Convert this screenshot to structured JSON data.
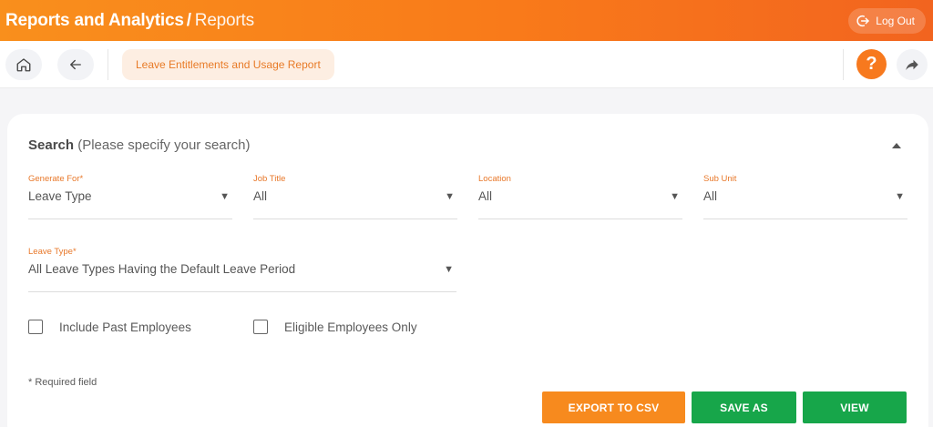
{
  "header": {
    "title": "Reports and Analytics",
    "separator": "/",
    "breadcrumb": "Reports",
    "logout_label": "Log Out"
  },
  "toolbar": {
    "home_icon": "home-icon",
    "back_icon": "arrow-left-icon",
    "active_tab": "Leave Entitlements and Usage Report",
    "help_label": "?",
    "share_icon": "share-icon"
  },
  "search": {
    "title": "Search",
    "subtitle": "(Please specify your search)",
    "fields": [
      {
        "label": "Generate For*",
        "value": "Leave Type"
      },
      {
        "label": "Job Title",
        "value": "All"
      },
      {
        "label": "Location",
        "value": "All"
      },
      {
        "label": "Sub Unit",
        "value": "All"
      },
      {
        "label": "Leave Type*",
        "value": "All Leave Types Having the Default Leave Period"
      }
    ],
    "checkboxes": [
      {
        "label": "Include Past Employees",
        "checked": false
      },
      {
        "label": "Eligible Employees Only",
        "checked": false
      }
    ],
    "required_note": "* Required field"
  },
  "actions": {
    "export_label": "EXPORT TO CSV",
    "save_as_label": "SAVE AS",
    "view_label": "VIEW"
  },
  "colors": {
    "brand_orange": "#f7791e",
    "action_green": "#17a64a",
    "label_orange": "#e8782a"
  }
}
